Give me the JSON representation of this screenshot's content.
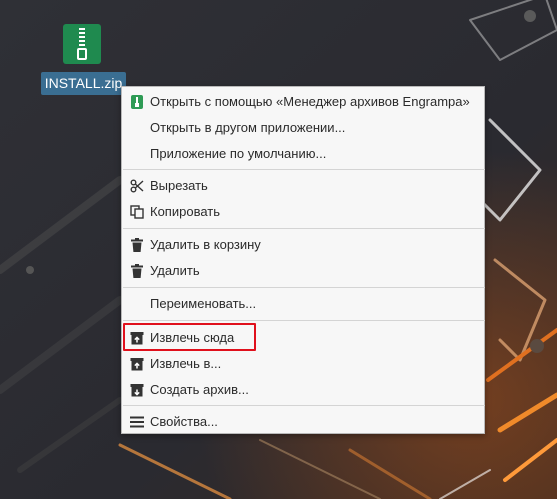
{
  "desktop": {
    "file_icon": {
      "label": "INSTALL.zip",
      "icon": "zip-archive-icon"
    }
  },
  "context_menu": {
    "open_with_app": "Открыть с помощью «Менеджер архивов Engrampa»",
    "open_other_app": "Открыть в другом приложении...",
    "default_app": "Приложение по умолчанию...",
    "cut": "Вырезать",
    "copy": "Копировать",
    "trash": "Удалить в корзину",
    "delete": "Удалить",
    "rename": "Переименовать...",
    "extract_here": "Извлечь сюда",
    "extract_to": "Извлечь в...",
    "create_archive": "Создать архив...",
    "properties": "Свойства..."
  },
  "colors": {
    "highlight": "#e0101c",
    "menu_bg": "#f7f7f7",
    "label_bg": "#3a6e92"
  }
}
